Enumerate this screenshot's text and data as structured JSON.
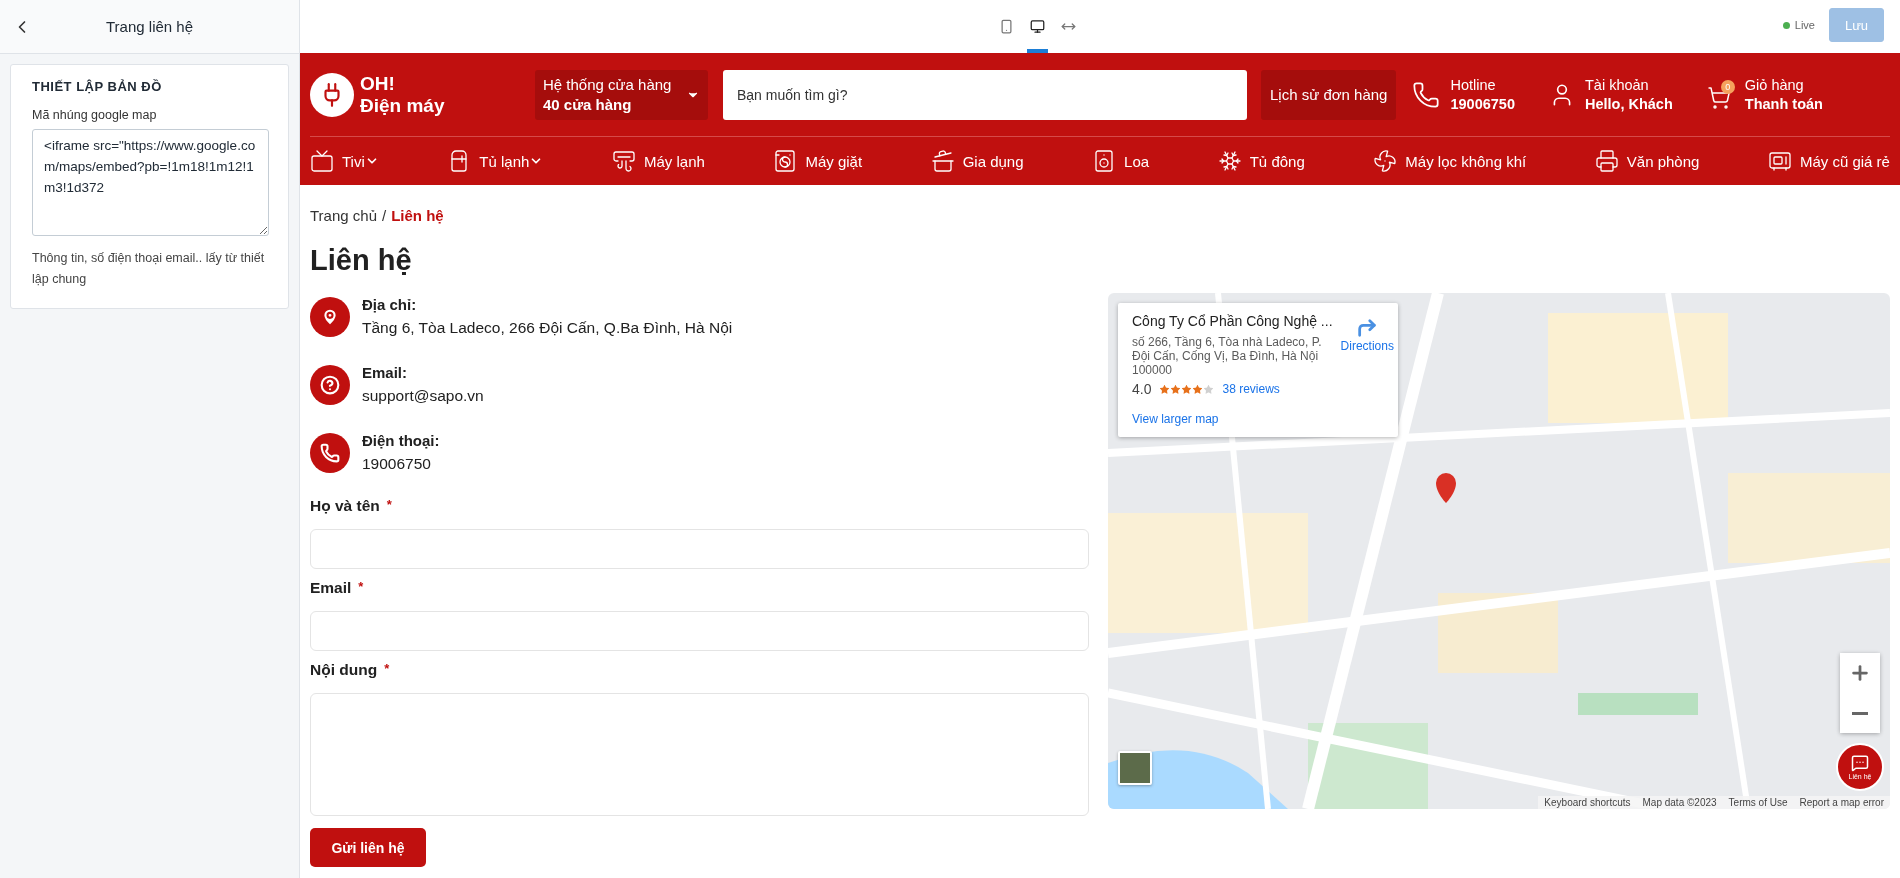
{
  "sidebar": {
    "title": "Trang liên hệ",
    "section": {
      "heading": "THIẾT LẬP BẢN ĐỒ",
      "field_label": "Mã nhúng google map",
      "embed_code": "<iframe src=\"https://www.google.com/maps/embed?pb=!1m18!1m12!1m3!1d372",
      "note": "Thông tin, số điện thoại email.. lấy từ thiết lập chung"
    }
  },
  "toolbar": {
    "devices": [
      {
        "kind": "mobile",
        "selected": false
      },
      {
        "kind": "desktop",
        "selected": true
      },
      {
        "kind": "fullwidth",
        "selected": false
      }
    ],
    "status": "Live",
    "save_button": {
      "label": "Lưu",
      "disabled": true
    }
  },
  "header": {
    "logo": {
      "line1": "OH!",
      "line2": "Điện máy"
    },
    "store": {
      "title": "Hệ thống cửa hàng",
      "count": "40 cửa hàng"
    },
    "search": {
      "placeholder": "Bạn muốn tìm gì?"
    },
    "order_history": "Lịch sử đơn hàng",
    "hotline": {
      "label": "Hotline",
      "value": "19006750"
    },
    "account": {
      "label": "Tài khoản",
      "value": "Hello, Khách"
    },
    "cart": {
      "label": "Giỏ hàng",
      "value": "Thanh toán",
      "badge": "0"
    }
  },
  "nav": [
    {
      "kind": "tv",
      "label": "Tivi",
      "has_dropdown": true
    },
    {
      "kind": "fridge",
      "label": "Tủ lạnh",
      "has_dropdown": true
    },
    {
      "kind": "aircon",
      "label": "Máy lạnh",
      "has_dropdown": false
    },
    {
      "kind": "washer",
      "label": "Máy giặt",
      "has_dropdown": false
    },
    {
      "kind": "cooker",
      "label": "Gia dụng",
      "has_dropdown": false
    },
    {
      "kind": "speaker",
      "label": "Loa",
      "has_dropdown": false
    },
    {
      "kind": "freezer",
      "label": "Tủ đông",
      "has_dropdown": false
    },
    {
      "kind": "purifier",
      "label": "Máy lọc không khí",
      "has_dropdown": false
    },
    {
      "kind": "printer",
      "label": "Văn phòng",
      "has_dropdown": false
    },
    {
      "kind": "used",
      "label": "Máy cũ giá rẻ",
      "has_dropdown": false
    }
  ],
  "breadcrumb": {
    "separator": "/",
    "items": [
      {
        "label": "Trang chủ",
        "current": false
      },
      {
        "label": "Liên hệ",
        "current": true
      }
    ]
  },
  "title": "Liên hệ",
  "contacts": [
    {
      "kind": "address",
      "label": "Địa chỉ:",
      "value": "Tầng 6, Tòa Ladeco, 266 Đội Cấn, Q.Ba Đình, Hà Nội"
    },
    {
      "kind": "email",
      "label": "Email:",
      "value": "support@sapo.vn"
    },
    {
      "kind": "phone",
      "label": "Điện thoại:",
      "value": "19006750"
    }
  ],
  "form": {
    "fields": [
      {
        "kind": "input",
        "label": "Họ và tên",
        "required_mark": "*"
      },
      {
        "kind": "input",
        "label": "Email",
        "required_mark": "*"
      },
      {
        "kind": "textarea",
        "label": "Nội dung",
        "required_mark": "*"
      }
    ],
    "submit": "Gửi liên hệ"
  },
  "map": {
    "kind": "picture",
    "card": {
      "title": "Công Ty Cổ Phần Công Nghệ ...",
      "address": "số 266, Tầng 6, Tòa nhà Ladeco, P. Đội Cấn, Cống Vị, Ba Đình, Hà Nội 100000",
      "rating": "4.0",
      "stars": 4,
      "reviews": "38 reviews",
      "directions": "Directions",
      "larger_map": "View larger map"
    },
    "footer": [
      "Keyboard shortcuts",
      "Map data ©2023",
      "Terms of Use",
      "Report a map error"
    ],
    "chat_button": "Liên hệ"
  }
}
